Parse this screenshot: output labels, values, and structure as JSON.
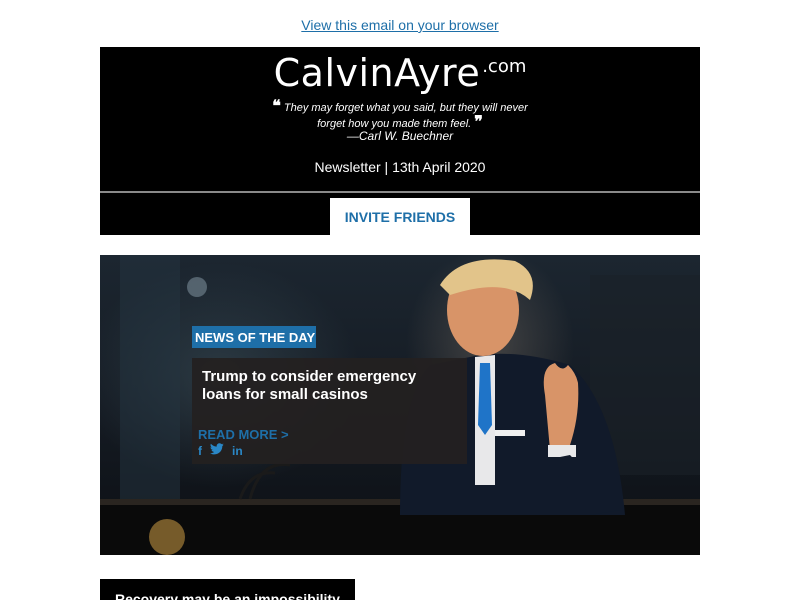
{
  "preheader": {
    "view_in_browser": "View this email on your browser"
  },
  "header": {
    "logo_main": "CalvinAyre",
    "logo_tld": ".com",
    "quote_text": "They may forget what you said, but they will never forget how you made them feel.",
    "quote_author": "—Carl W. Buechner",
    "newsletter_date": "Newsletter | 13th April 2020"
  },
  "invite": {
    "label": "INVITE FRIENDS"
  },
  "feature": {
    "badge": "NEWS OF THE DAY",
    "title": "Trump to consider emergency loans for small casinos",
    "read_more": "READ MORE >",
    "social": {
      "facebook": "f",
      "linkedin": "in"
    }
  },
  "article2": {
    "title": "Recovery may be an impossibility"
  },
  "colors": {
    "accent": "#1e6fa8",
    "header_bg": "#000000",
    "news_box_bg": "#232020"
  }
}
